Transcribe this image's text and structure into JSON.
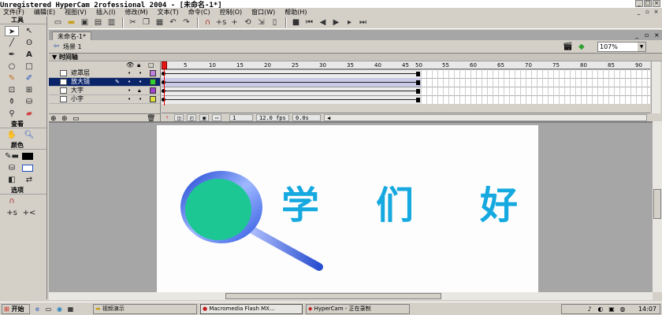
{
  "window": {
    "title": "Unregistered HyperCam 2rofessional 2004 - [未命名-1*]"
  },
  "menu": [
    "文件(F)",
    "编辑(E)",
    "视图(V)",
    "插入(I)",
    "修改(M)",
    "文本(T)",
    "命令(C)",
    "控制(O)",
    "窗口(W)",
    "帮助(H)"
  ],
  "tools": {
    "header_tools": "工具",
    "header_view": "查看",
    "header_colors": "颜色",
    "header_options": "选项"
  },
  "document": {
    "tab": "未命名-1*",
    "scene": "场景 1",
    "zoom": "107%"
  },
  "timeline": {
    "header": "时间轴",
    "layers": [
      {
        "name": "遮罩层",
        "color": "#c080e0"
      },
      {
        "name": "放大镜",
        "color": "#30d030"
      },
      {
        "name": "大字",
        "color": "#a040d0"
      },
      {
        "name": "小字",
        "color": "#e0e040"
      }
    ],
    "ruler": [
      "5",
      "10",
      "15",
      "20",
      "25",
      "30",
      "35",
      "40",
      "45",
      "50",
      "55",
      "60",
      "65",
      "70",
      "75",
      "80",
      "85",
      "90"
    ],
    "frame": "1",
    "fps": "12.0 fps",
    "time": "0.0s"
  },
  "stage": {
    "chars": [
      "学",
      "们",
      "好"
    ],
    "lens_fill": "#1cc794",
    "text_color": "#15a9e0"
  },
  "taskbar": {
    "start": "开始",
    "items": [
      "视频演示",
      "Macromedia Flash MX...",
      "HyperCam - 正在录制"
    ],
    "clock": "14:07"
  }
}
